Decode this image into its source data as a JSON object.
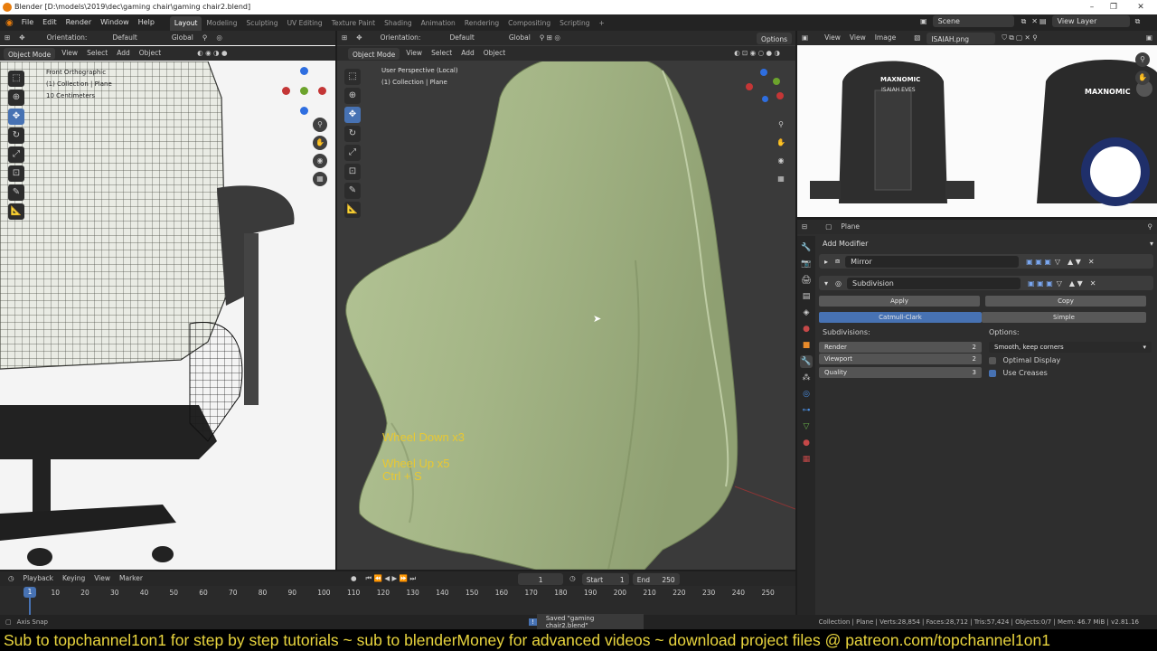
{
  "window": {
    "title": "Blender [D:\\models\\2019\\dec\\gaming chair\\gaming chair2.blend]"
  },
  "topbar": {
    "menus": [
      "File",
      "Edit",
      "Render",
      "Window",
      "Help"
    ],
    "workspaces": [
      "Layout",
      "Modeling",
      "Sculpting",
      "UV Editing",
      "Texture Paint",
      "Shading",
      "Animation",
      "Rendering",
      "Compositing",
      "Scripting",
      "+"
    ],
    "active_workspace": "Layout",
    "scene": "Scene",
    "view_layer": "View Layer"
  },
  "left_viewport": {
    "orientation_label": "Orientation:",
    "orientation_value": "Default",
    "transform_space": "Global",
    "mode": "Object Mode",
    "menus": [
      "View",
      "Select",
      "Add",
      "Object"
    ],
    "overlay_lines": [
      "Front Orthographic",
      "(1) Collection | Plane",
      "10 Centimeters"
    ]
  },
  "center_viewport": {
    "orientation_label": "Orientation:",
    "orientation_value": "Default",
    "transform_space": "Global",
    "options": "Options",
    "mode": "Object Mode",
    "menus": [
      "View",
      "Select",
      "Add",
      "Object"
    ],
    "overlay_lines": [
      "User Perspective (Local)",
      "(1) Collection | Plane"
    ],
    "key_hints": [
      "Wheel Down x3",
      "Wheel Up x5",
      "Ctrl + S"
    ]
  },
  "image_editor": {
    "menus": [
      "View",
      "View",
      "Image"
    ],
    "image_name": "ISAIAH.png",
    "brand_left": "MAXNOMIC",
    "name_left": "ISAIAH EVES",
    "brand_right": "MAXNOMIC"
  },
  "properties": {
    "object_name": "Plane",
    "add_modifier": "Add Modifier",
    "modifiers": [
      {
        "name": "Mirror",
        "expanded": false
      },
      {
        "name": "Subdivision",
        "expanded": true
      }
    ],
    "apply": "Apply",
    "copy": "Copy",
    "algo_a": "Catmull-Clark",
    "algo_b": "Simple",
    "subdivisions_label": "Subdivisions:",
    "render_label": "Render",
    "render_value": "2",
    "viewport_label": "Viewport",
    "viewport_value": "2",
    "quality_label": "Quality",
    "quality_value": "3",
    "options_label": "Options:",
    "uv_smooth": "Smooth, keep corners",
    "optimal_display": "Optimal Display",
    "optimal_display_checked": false,
    "use_creases": "Use Creases",
    "use_creases_checked": true
  },
  "timeline": {
    "menus": [
      "Playback",
      "Keying",
      "View",
      "Marker"
    ],
    "current_frame": "1",
    "start_label": "Start",
    "start": "1",
    "end_label": "End",
    "end": "250",
    "ticks": [
      "10",
      "20",
      "30",
      "40",
      "50",
      "60",
      "70",
      "80",
      "90",
      "100",
      "110",
      "120",
      "130",
      "140",
      "150",
      "160",
      "170",
      "180",
      "190",
      "200",
      "210",
      "220",
      "230",
      "240",
      "250"
    ],
    "playhead": "1"
  },
  "status": {
    "left": "Axis Snap",
    "saved": "Saved \"gaming chair2.blend\"",
    "stats": "Collection | Plane | Verts:28,854 | Faces:28,712 | Tris:57,424 | Objects:0/7 | Mem: 46.7 MiB | v2.81.16"
  },
  "banner": {
    "text": "Sub to topchannel1on1 for step by step tutorials ~ sub to blenderMoney for advanced videos ~ download project files @ patreon.com/topchannel1on1"
  },
  "colors": {
    "accent": "#4772b3",
    "mesh": "#a9b98a",
    "banner_text": "#e9d53e"
  }
}
